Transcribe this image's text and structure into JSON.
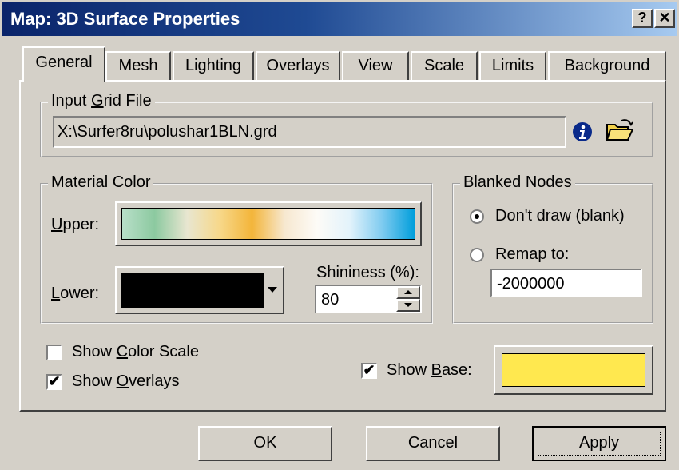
{
  "window": {
    "title": "Map: 3D Surface Properties",
    "help_label": "?",
    "close_label": "✕"
  },
  "tabs": [
    {
      "label": "General"
    },
    {
      "label": "Mesh"
    },
    {
      "label": "Lighting"
    },
    {
      "label": "Overlays"
    },
    {
      "label": "View"
    },
    {
      "label": "Scale"
    },
    {
      "label": "Limits"
    },
    {
      "label": "Background"
    }
  ],
  "input_grid": {
    "group_label_pre": "Input ",
    "group_label_ul": "G",
    "group_label_post": "rid File",
    "value": "X:\\Surfer8ru\\polushar1BLN.grd",
    "info_icon": "info-icon",
    "open_icon": "open-folder-icon"
  },
  "material_color": {
    "group_label": "Material Color",
    "upper_ul": "U",
    "upper_rest": "pper:",
    "lower_ul": "L",
    "lower_rest": "ower:",
    "lower_color": "#000000",
    "upper_gradient": [
      "#b8dfc8",
      "#8cc9a0",
      "#e8e6d0",
      "#f7d88a",
      "#f3b53a",
      "#f7e8d0",
      "#fdfbf7",
      "#e3f3fb",
      "#7fcbf0",
      "#009edb"
    ],
    "shininess_label": "Shininess (%):",
    "shininess_value": "80"
  },
  "blanked_nodes": {
    "group_label": "Blanked Nodes",
    "option_dont_draw": "Don't draw (blank)",
    "option_remap": "Remap to:",
    "remap_value": "-2000000",
    "selected": "dont_draw"
  },
  "options": {
    "show_color_scale_pre": "Show ",
    "show_color_scale_ul": "C",
    "show_color_scale_post": "olor Scale",
    "show_color_scale_checked": false,
    "show_overlays_pre": "Show ",
    "show_overlays_ul": "O",
    "show_overlays_post": "verlays",
    "show_overlays_checked": true,
    "show_base_pre": "Show ",
    "show_base_ul": "B",
    "show_base_post": "ase:",
    "show_base_checked": true,
    "base_color": "#ffe84f"
  },
  "buttons": {
    "ok": "OK",
    "cancel": "Cancel",
    "apply": "Apply"
  }
}
